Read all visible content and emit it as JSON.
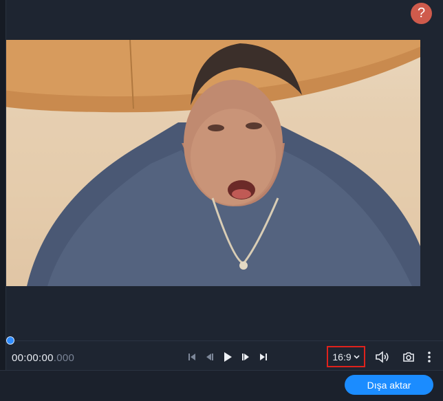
{
  "help": {
    "label": "?"
  },
  "player": {
    "progress": 0,
    "timecode_main": "00:00:00",
    "timecode_ms": ".000",
    "aspect_ratio": "16:9",
    "controls": [
      "skip-to-start",
      "previous-frame",
      "play",
      "next-frame",
      "skip-to-end"
    ]
  },
  "footer": {
    "export_label": "Dışa aktar"
  },
  "colors": {
    "accent": "#1b8cff",
    "help_bg": "#cf5b4c",
    "highlight_border": "#e0221c",
    "background": "#1e2531"
  }
}
